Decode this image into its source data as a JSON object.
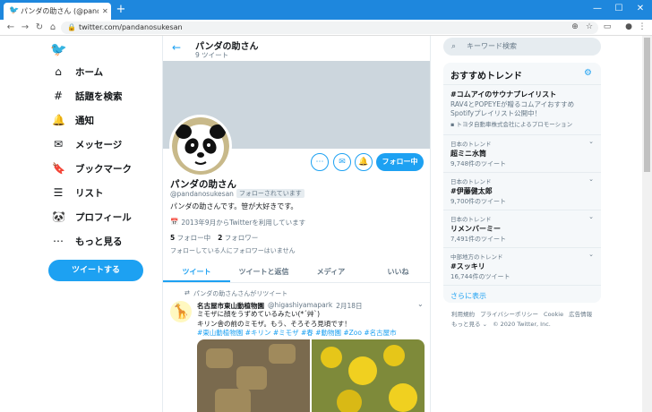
{
  "browser": {
    "tab_title": "パンダの助さん (@pandanosuke",
    "new_tab": "+",
    "url": "twitter.com/pandanosukesan",
    "controls": {
      "minimize": "—",
      "maximize": "☐",
      "close": "✕"
    }
  },
  "nav": {
    "items": [
      {
        "label": "ホーム",
        "icon": "home-icon"
      },
      {
        "label": "話題を検索",
        "icon": "hashtag-icon"
      },
      {
        "label": "通知",
        "icon": "bell-icon"
      },
      {
        "label": "メッセージ",
        "icon": "mail-icon"
      },
      {
        "label": "ブックマーク",
        "icon": "bookmark-icon"
      },
      {
        "label": "リスト",
        "icon": "list-icon"
      },
      {
        "label": "プロフィール",
        "icon": "profile-icon"
      },
      {
        "label": "もっと見る",
        "icon": "more-icon"
      }
    ],
    "tweet_button": "ツイートする"
  },
  "profile": {
    "header_name": "パンダの助さん",
    "tweet_count": "9 ツイート",
    "name": "パンダの助さん",
    "handle": "@pandanosukesan",
    "follows_you": "フォローされています",
    "bio": "パンダの助さんです。笹が大好きです。",
    "joined": "2013年9月からTwitterを利用しています",
    "following_count": "5",
    "following_label": "フォロー中",
    "followers_count": "2",
    "followers_label": "フォロワー",
    "follower_note": "フォローしている人にフォロワーはいません",
    "follow_button": "フォロー中",
    "tabs": [
      "ツイート",
      "ツイートと返信",
      "メディア",
      "いいね"
    ]
  },
  "tweet": {
    "retweet_note": "パンダの助さんさんがリツイート",
    "author": "名古屋市東山動植物園",
    "handle": "@higashiyamapark",
    "date": "2月18日",
    "text": "ミモザに顔をうずめているみたい(*´艸`)\nキリン舎の前のミモザ。もう、そろそろ見頃です！",
    "tags": "#東山動植物園 #キリン #ミモザ #春 #動物園 #Zoo #名古屋市"
  },
  "right": {
    "search_placeholder": "キーワード検索",
    "trends_title": "おすすめトレンド",
    "promo": {
      "name": "#コムアイのサウナプレイリスト",
      "desc": "RAV4とPOPEYEが贈るコムアイおすすめSpotifyプレイリスト公開中！",
      "by": "トヨタ自動車株式会社によるプロモーション"
    },
    "trends": [
      {
        "ctx": "日本のトレンド",
        "name": "超ミニ水筒",
        "count": "9,748件のツイート"
      },
      {
        "ctx": "日本のトレンド",
        "name": "#伊藤健太郎",
        "count": "9,700件のツイート"
      },
      {
        "ctx": "日本のトレンド",
        "name": "リメンバーミー",
        "count": "7,491件のツイート"
      },
      {
        "ctx": "中部地方のトレンド",
        "name": "#スッキリ",
        "count": "16,744件のツイート"
      }
    ],
    "show_more": "さらに表示",
    "footer": [
      "利用規約",
      "プライバシーポリシー",
      "Cookie",
      "広告情報",
      "もっと見る ⌄",
      "© 2020 Twitter, Inc."
    ]
  }
}
